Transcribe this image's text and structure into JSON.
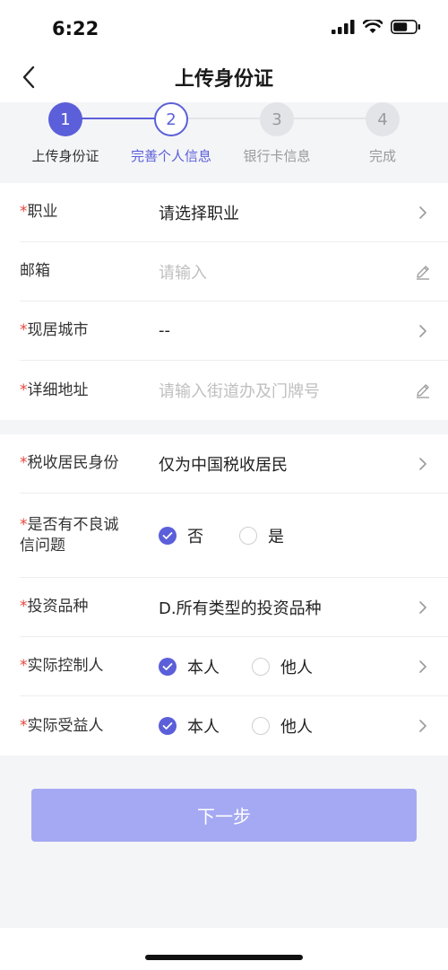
{
  "status_bar": {
    "time": "6:22"
  },
  "header": {
    "title": "上传身份证"
  },
  "colors": {
    "accent": "#5b5fd9",
    "button_disabled": "#a5a8f2",
    "required": "#e6453a"
  },
  "steps": [
    {
      "number": "1",
      "label": "上传身份证",
      "state": "done"
    },
    {
      "number": "2",
      "label": "完善个人信息",
      "state": "current"
    },
    {
      "number": "3",
      "label": "银行卡信息",
      "state": "pending"
    },
    {
      "number": "4",
      "label": "完成",
      "state": "pending"
    }
  ],
  "section1": {
    "occupation": {
      "required_mark": "*",
      "label": "职业",
      "value": "请选择职业",
      "icon": "chevron-right-icon"
    },
    "email": {
      "label": "邮箱",
      "placeholder": "请输入",
      "icon": "pencil-icon"
    },
    "city": {
      "required_mark": "*",
      "label": "现居城市",
      "value": "--",
      "icon": "chevron-right-icon"
    },
    "address": {
      "required_mark": "*",
      "label": "详细地址",
      "placeholder": "请输入街道办及门牌号",
      "icon": "pencil-icon"
    }
  },
  "section2": {
    "tax_residency": {
      "required_mark": "*",
      "label": "税收居民身份",
      "value": "仅为中国税收居民",
      "icon": "chevron-right-icon"
    },
    "credit_issue": {
      "required_mark": "*",
      "label_line1": "是否有不良诚",
      "label_line2": "信问题",
      "option_no": "否",
      "option_yes": "是",
      "selected": "否"
    },
    "investment_type": {
      "required_mark": "*",
      "label": "投资品种",
      "value": "D.所有类型的投资品种",
      "icon": "chevron-right-icon"
    },
    "controller": {
      "required_mark": "*",
      "label": "实际控制人",
      "option_self": "本人",
      "option_other": "他人",
      "selected": "本人",
      "icon": "chevron-right-icon"
    },
    "beneficiary": {
      "required_mark": "*",
      "label": "实际受益人",
      "option_self": "本人",
      "option_other": "他人",
      "selected": "本人",
      "icon": "chevron-right-icon"
    }
  },
  "submit": {
    "label": "下一步"
  }
}
